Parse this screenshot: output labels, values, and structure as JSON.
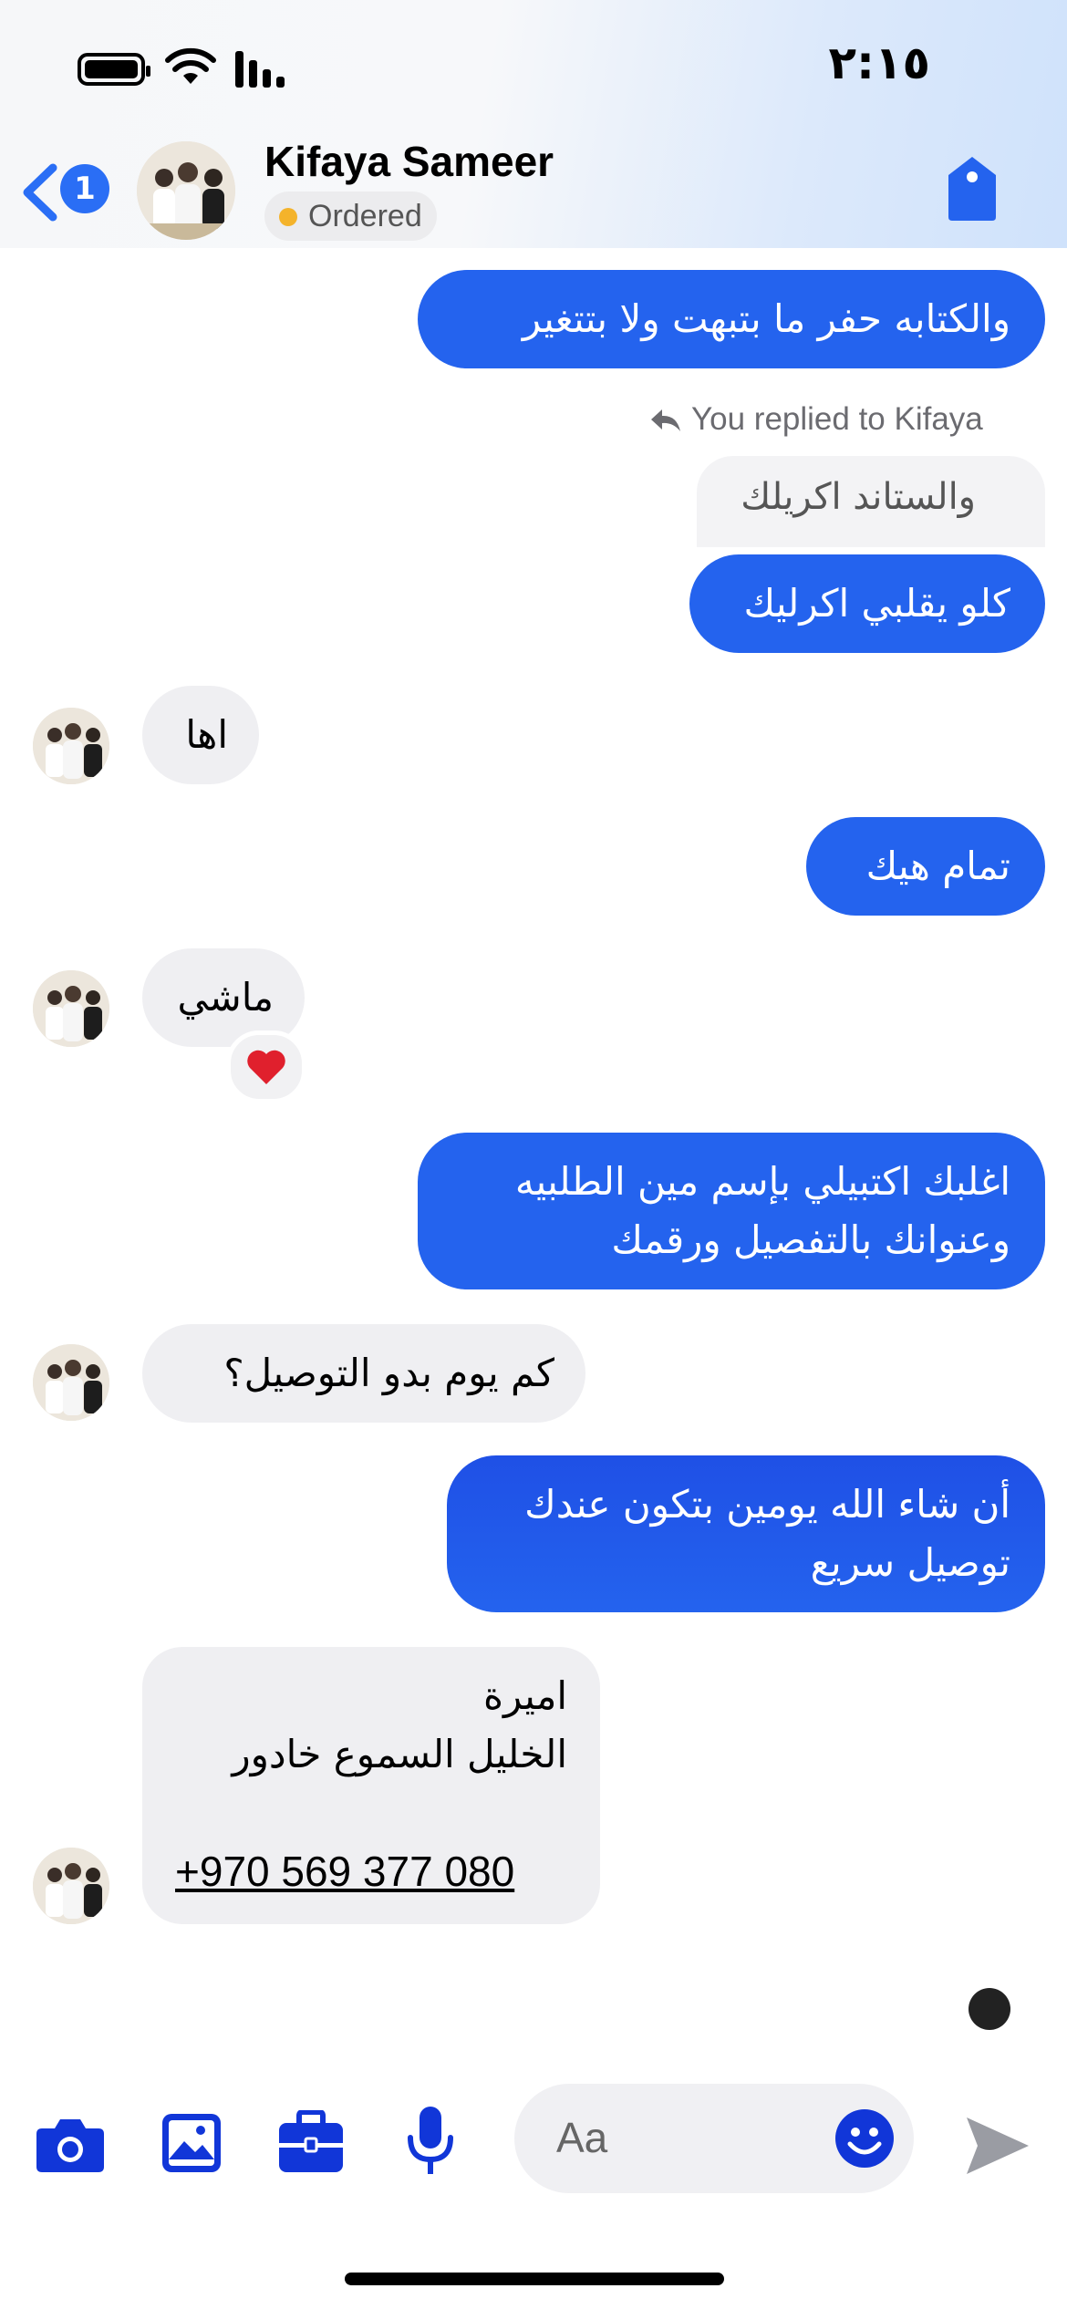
{
  "status_bar": {
    "time": "٢:١٥"
  },
  "header": {
    "back_count": "1",
    "contact_name": "Kifaya Sameer",
    "status_label": "Ordered"
  },
  "messages": [
    {
      "dir": "out",
      "text": "والكتابه حفر ما بتبهت ولا بتتغير"
    },
    {
      "dir": "reply_note",
      "text": "You replied to Kifaya"
    },
    {
      "dir": "quoted",
      "text": "والستاند اكريلك"
    },
    {
      "dir": "out",
      "text": "كلو يقلبي اكرليك"
    },
    {
      "dir": "in",
      "text": "اها"
    },
    {
      "dir": "out",
      "text": "تمام هيك"
    },
    {
      "dir": "in",
      "text": "ماشي",
      "reaction": "❤️"
    },
    {
      "dir": "out",
      "text": "اغلبك اكتبيلي بإسم مين الطلبيه\nوعنوانك بالتفصيل ورقمك"
    },
    {
      "dir": "in",
      "text": "كم يوم بدو التوصيل؟"
    },
    {
      "dir": "out",
      "text": "أن شاء الله يومين بتكون عندك\nتوصيل سريع"
    },
    {
      "dir": "in",
      "line1": "اميرة",
      "line2": "الخليل السموع خادور",
      "phone": "+970 569 377 080"
    }
  ],
  "composer": {
    "placeholder": "Aa"
  },
  "colors": {
    "accent": "#2463ee",
    "incoming": "#efeff2",
    "icon": "#1136d8"
  }
}
